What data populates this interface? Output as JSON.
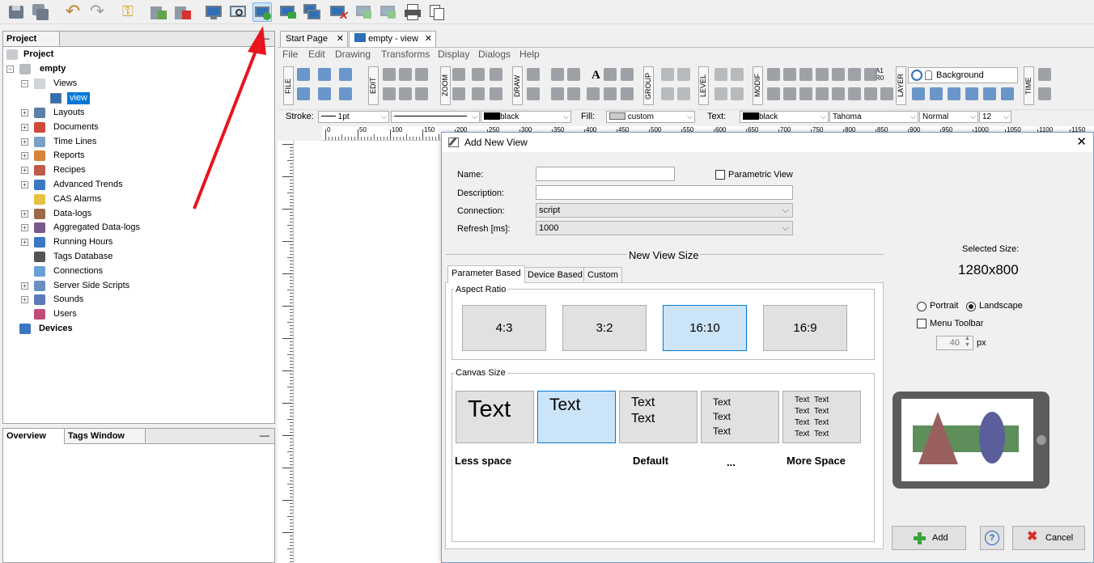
{
  "toolbar": {
    "icons": [
      "save-icon",
      "save-all-icon",
      "undo-icon",
      "redo-icon",
      "key-icon",
      "import-icon",
      "export-icon",
      "monitor-icon",
      "preview-icon",
      "add-view-icon",
      "view-icon",
      "duplicate-view-icon",
      "delete-view-icon",
      "move-up-icon",
      "move-down-icon",
      "print-icon",
      "copy-icon"
    ]
  },
  "project_panel": {
    "tab_label": "Project",
    "minimize": "—",
    "tree": {
      "root": "Project",
      "project_name": "empty",
      "views_label": "Views",
      "view_item": "view",
      "items": [
        "Layouts",
        "Documents",
        "Time Lines",
        "Reports",
        "Recipes",
        "Advanced Trends",
        "CAS Alarms",
        "Data-logs",
        "Aggregated Data-logs",
        "Running Hours",
        "Tags Database",
        "Connections",
        "Server Side Scripts",
        "Sounds",
        "Users"
      ],
      "devices": "Devices"
    }
  },
  "bottom_panel": {
    "tabs": [
      "Overview",
      "Tags Window"
    ],
    "minimize": "—"
  },
  "editor": {
    "tabs": [
      {
        "label": "Start Page",
        "close": "✕"
      },
      {
        "label": "empty - view",
        "close": "✕"
      }
    ],
    "menu": [
      "File",
      "Edit",
      "Drawing",
      "Transforms",
      "Display",
      "Dialogs",
      "Help"
    ],
    "group_labels": [
      "FILE",
      "EDIT",
      "ZOOM",
      "DRAW",
      "GROUP",
      "LEVEL",
      "MODIF",
      "LAYER",
      "TIME"
    ],
    "layer_name": "Background",
    "draw_label_a": "A",
    "a1r0": "A1\nR0",
    "props": {
      "stroke_label": "Stroke:",
      "stroke_width": "1pt",
      "stroke_color": "black",
      "fill_label": "Fill:",
      "fill_value": "custom",
      "text_label": "Text:",
      "text_color": "black",
      "font": "Tahoma",
      "style": "Normal",
      "size": "12"
    },
    "ruler_labels": [
      "0",
      "50",
      "100",
      "150",
      "200",
      "250",
      "300",
      "350",
      "400",
      "450",
      "500",
      "550",
      "600",
      "650",
      "700",
      "750",
      "800",
      "850",
      "900",
      "950",
      "1000",
      "1050",
      "1100",
      "1150"
    ]
  },
  "dialog": {
    "title": "Add New View",
    "close": "✕",
    "name_label": "Name:",
    "name_value": "",
    "parametric_label": "Parametric View",
    "description_label": "Description:",
    "description_value": "",
    "connection_label": "Connection:",
    "connection_value": "script",
    "refresh_label": "Refresh [ms]:",
    "refresh_value": "1000",
    "size_section": "New View Size",
    "tabs": [
      "Parameter Based",
      "Device Based",
      "Custom"
    ],
    "aspect_ratio_label": "Aspect Ratio",
    "aspect_ratios": [
      "4:3",
      "3:2",
      "16:10",
      "16:9"
    ],
    "aspect_selected": 2,
    "canvas_size_label": "Canvas Size",
    "canvas_text": "Text",
    "canvas_labels": [
      "Less space",
      "Default",
      "...",
      "More Space"
    ],
    "selected_size_label": "Selected Size:",
    "selected_size": "1280x800",
    "portrait_label": "Portrait",
    "landscape_label": "Landscape",
    "orientation": "landscape",
    "menu_toolbar_label": "Menu Toolbar",
    "menu_toolbar_px": "40",
    "px_label": "px",
    "add_label": "Add",
    "help_label": "?",
    "cancel_label": "Cancel"
  },
  "colors": {
    "selection_blue": "#cce4f7",
    "accent": "#0078d7",
    "arrow_red": "#e8141e",
    "tablet_green": "#5e8f5a",
    "tablet_triangle": "#9a5f5f",
    "tablet_ellipse": "#5a5e9b"
  }
}
